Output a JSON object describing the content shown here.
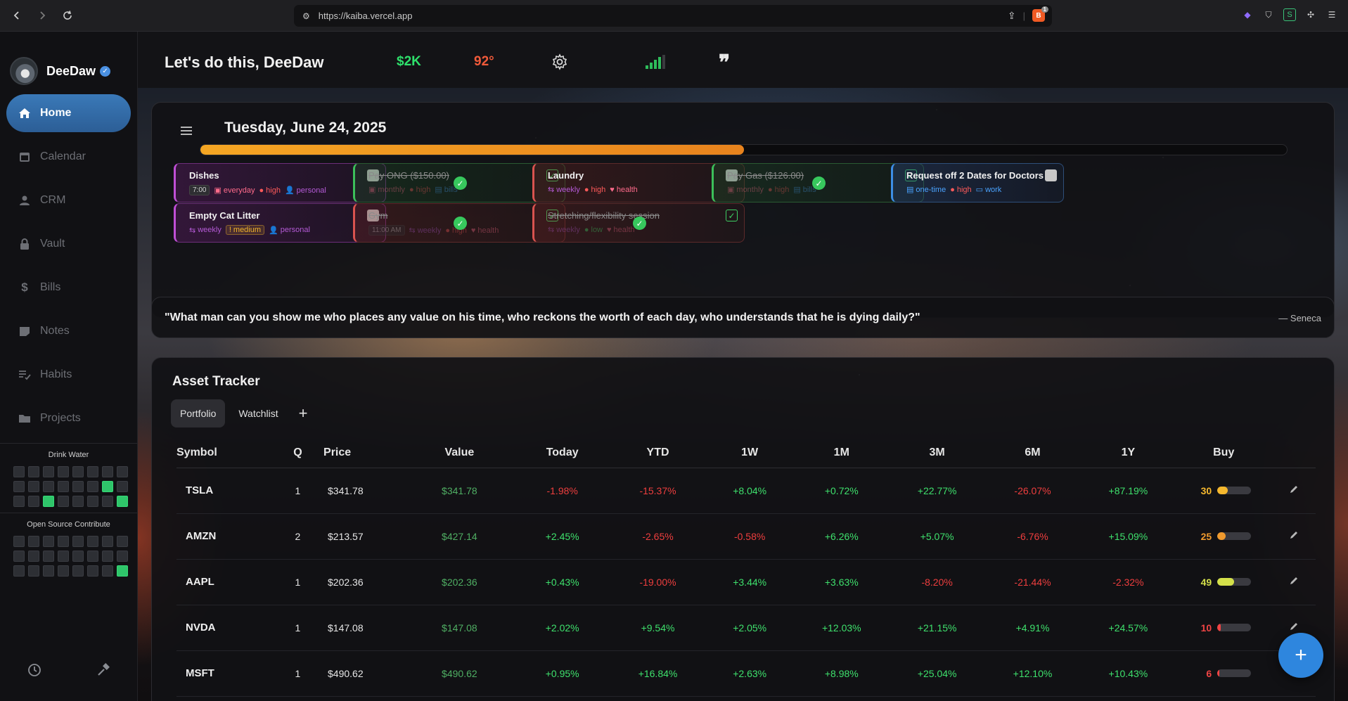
{
  "browser": {
    "url": "https://kaiba.vercel.app",
    "brave_count": "1"
  },
  "sidebar": {
    "user_name": "DeeDaw",
    "items": [
      {
        "label": "Home",
        "icon": "home-icon",
        "active": true
      },
      {
        "label": "Calendar",
        "icon": "calendar-icon"
      },
      {
        "label": "CRM",
        "icon": "person-icon"
      },
      {
        "label": "Vault",
        "icon": "lock-icon"
      },
      {
        "label": "Bills",
        "icon": "dollar-icon"
      },
      {
        "label": "Notes",
        "icon": "note-icon"
      },
      {
        "label": "Habits",
        "icon": "checklist-icon"
      },
      {
        "label": "Projects",
        "icon": "folder-icon"
      }
    ],
    "habits": [
      {
        "title": "Drink Water",
        "cells": [
          0,
          0,
          0,
          0,
          0,
          0,
          0,
          0,
          0,
          0,
          0,
          0,
          0,
          0,
          1,
          0,
          0,
          0,
          1,
          0,
          0,
          0,
          0,
          1
        ]
      },
      {
        "title": "Open Source Contribute",
        "cells": [
          0,
          0,
          0,
          0,
          0,
          0,
          0,
          0,
          0,
          0,
          0,
          0,
          0,
          0,
          0,
          0,
          0,
          0,
          0,
          0,
          0,
          0,
          0,
          1
        ]
      }
    ]
  },
  "header": {
    "greeting": "Let's do this, DeeDaw",
    "money": "$2K",
    "temperature": "92°",
    "quote_icon": "❞"
  },
  "tasks": {
    "date": "Tuesday, June 24, 2025",
    "progress_percent": 50,
    "items": [
      {
        "title": "Dishes",
        "color": "purple",
        "done": false,
        "time": "7:00",
        "chips": [
          {
            "text": "everyday",
            "cls": "c-pink",
            "icon": "▣"
          },
          {
            "text": "high",
            "cls": "c-red",
            "icon": "●"
          },
          {
            "text": "personal",
            "cls": "c-purple",
            "icon": "👤"
          }
        ]
      },
      {
        "title": "Pay ONG ($150.00)",
        "color": "green",
        "done": true,
        "chips": [
          {
            "text": "monthly",
            "cls": "c-pink",
            "icon": "▣"
          },
          {
            "text": "high",
            "cls": "c-red",
            "icon": "●"
          },
          {
            "text": "bills",
            "cls": "c-blue",
            "icon": "▤"
          }
        ]
      },
      {
        "title": "Laundry",
        "color": "red",
        "done": false,
        "chips": [
          {
            "text": "weekly",
            "cls": "c-purple",
            "icon": "⇆"
          },
          {
            "text": "high",
            "cls": "c-red",
            "icon": "●"
          },
          {
            "text": "health",
            "cls": "c-pink",
            "icon": "♥"
          }
        ]
      },
      {
        "title": "Pay Gas ($126.00)",
        "color": "green",
        "done": true,
        "chips": [
          {
            "text": "monthly",
            "cls": "c-pink",
            "icon": "▣"
          },
          {
            "text": "high",
            "cls": "c-red",
            "icon": "●"
          },
          {
            "text": "bills",
            "cls": "c-blue",
            "icon": "▤"
          }
        ]
      },
      {
        "title": "Request off 2 Dates for Doctors",
        "color": "blue",
        "done": false,
        "chips": [
          {
            "text": "one-time",
            "cls": "c-blue",
            "icon": "▤"
          },
          {
            "text": "high",
            "cls": "c-red",
            "icon": "●"
          },
          {
            "text": "work",
            "cls": "c-blue",
            "icon": "▭"
          }
        ]
      },
      {
        "title": "Empty Cat Litter",
        "color": "purple",
        "done": false,
        "chips": [
          {
            "text": "weekly",
            "cls": "c-purple",
            "icon": "⇆"
          },
          {
            "text": "medium",
            "cls": "c-amber medium",
            "icon": "!"
          },
          {
            "text": "personal",
            "cls": "c-purple",
            "icon": "👤"
          }
        ]
      },
      {
        "title": "Gym",
        "color": "red",
        "done": true,
        "time": "11:00 AM",
        "chips": [
          {
            "text": "weekly",
            "cls": "c-purple",
            "icon": "⇆"
          },
          {
            "text": "high",
            "cls": "c-red",
            "icon": "●"
          },
          {
            "text": "health",
            "cls": "c-pink",
            "icon": "♥"
          }
        ]
      },
      {
        "title": "Stretching/flexibility session",
        "color": "red",
        "done": true,
        "chips": [
          {
            "text": "weekly",
            "cls": "c-purple",
            "icon": "⇆"
          },
          {
            "text": "low",
            "cls": "pos",
            "icon": "●"
          },
          {
            "text": "health",
            "cls": "c-pink",
            "icon": "♥"
          }
        ]
      }
    ]
  },
  "quote": {
    "text": "\"What man can you show me who places any value on his time, who reckons the worth of each day, who understands that he is dying daily?\"",
    "author": "— Seneca"
  },
  "assets": {
    "title": "Asset Tracker",
    "tabs": [
      "Portfolio",
      "Watchlist"
    ],
    "add_tab": "+",
    "columns": [
      "Symbol",
      "Q",
      "Price",
      "Value",
      "Today",
      "YTD",
      "1W",
      "1M",
      "3M",
      "6M",
      "1Y",
      "Buy"
    ],
    "rows": [
      {
        "symbol": "TSLA",
        "q": "1",
        "price": "$341.78",
        "value": "$341.78",
        "today": "-1.98%",
        "ytd": "-15.37%",
        "w1": "+8.04%",
        "m1": "+0.72%",
        "m3": "+22.77%",
        "m6": "-26.07%",
        "y1": "+87.19%",
        "buy": 30,
        "buy_color": "#f5b82e"
      },
      {
        "symbol": "AMZN",
        "q": "2",
        "price": "$213.57",
        "value": "$427.14",
        "today": "+2.45%",
        "ytd": "-2.65%",
        "w1": "-0.58%",
        "m1": "+6.26%",
        "m3": "+5.07%",
        "m6": "-6.76%",
        "y1": "+15.09%",
        "buy": 25,
        "buy_color": "#f09a2e"
      },
      {
        "symbol": "AAPL",
        "q": "1",
        "price": "$202.36",
        "value": "$202.36",
        "today": "+0.43%",
        "ytd": "-19.00%",
        "w1": "+3.44%",
        "m1": "+3.63%",
        "m3": "-8.20%",
        "m6": "-21.44%",
        "y1": "-2.32%",
        "buy": 49,
        "buy_color": "#d4e04a"
      },
      {
        "symbol": "NVDA",
        "q": "1",
        "price": "$147.08",
        "value": "$147.08",
        "today": "+2.02%",
        "ytd": "+9.54%",
        "w1": "+2.05%",
        "m1": "+12.03%",
        "m3": "+21.15%",
        "m6": "+4.91%",
        "y1": "+24.57%",
        "buy": 10,
        "buy_color": "#ef4444"
      },
      {
        "symbol": "MSFT",
        "q": "1",
        "price": "$490.62",
        "value": "$490.62",
        "today": "+0.95%",
        "ytd": "+16.84%",
        "w1": "+2.63%",
        "m1": "+8.98%",
        "m3": "+25.04%",
        "m6": "+12.10%",
        "y1": "+10.43%",
        "buy": 6,
        "buy_color": "#ef4444"
      }
    ]
  },
  "fab": "+"
}
